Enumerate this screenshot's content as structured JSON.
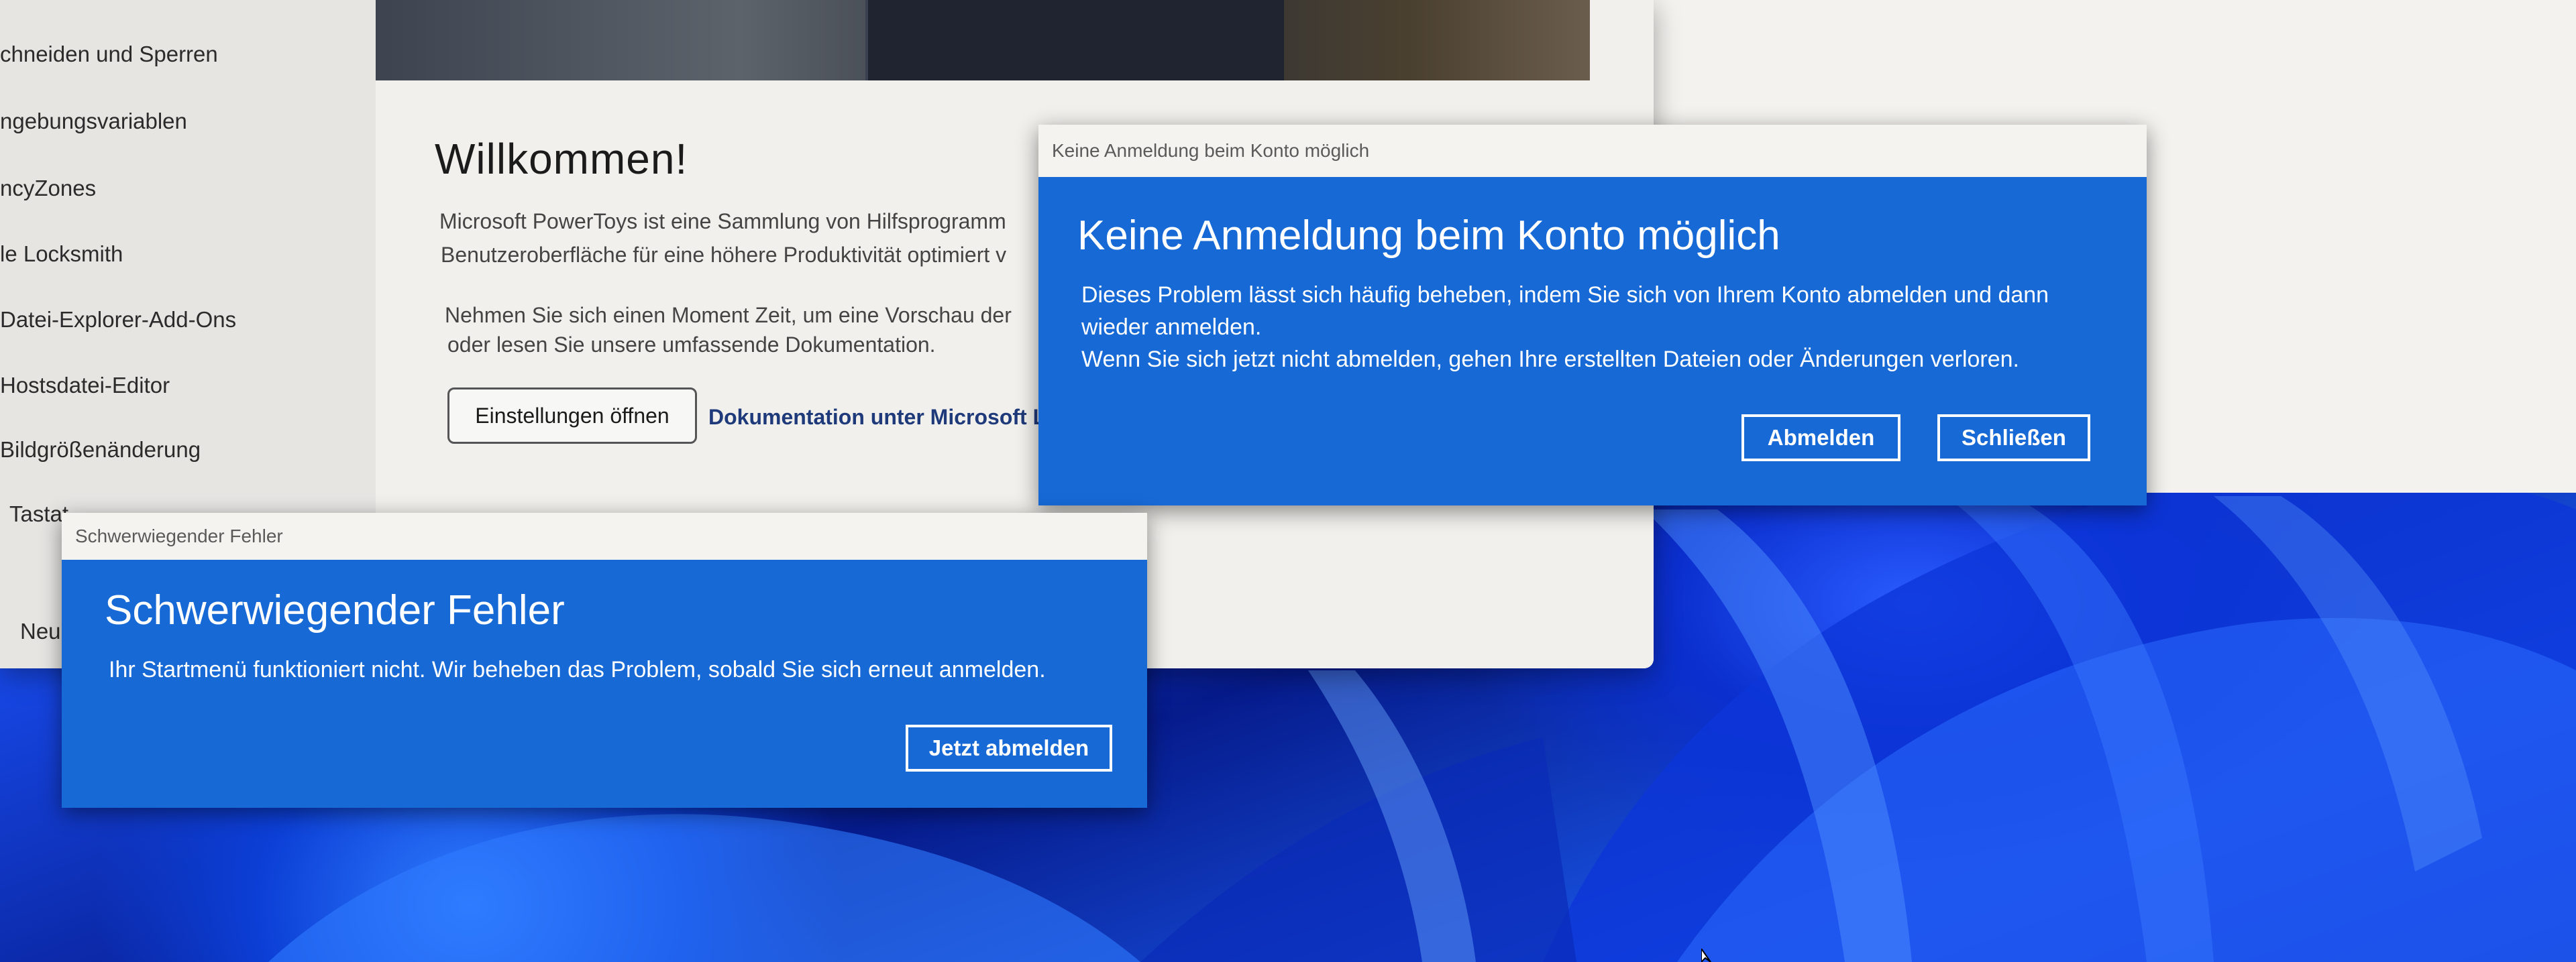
{
  "sidebar": {
    "items": [
      {
        "label": "chneiden und Sperren"
      },
      {
        "label": "ngebungsvariablen"
      },
      {
        "label": "ncyZones"
      },
      {
        "label": "le Locksmith"
      },
      {
        "label": "Datei-Explorer-Add-Ons"
      },
      {
        "label": "Hostsdatei-Editor"
      },
      {
        "label": "Bildgrößenänderung"
      },
      {
        "label": "Tastat"
      },
      {
        "label": "Neui"
      }
    ]
  },
  "welcome": {
    "title": "Willkommen!",
    "para1_line1": "Microsoft PowerToys ist eine Sammlung von Hilfsprogramm",
    "para1_line2": "Benutzeroberfläche für eine höhere Produktivität optimiert v",
    "para2_line1": "Nehmen Sie sich einen Moment Zeit, um eine Vorschau der",
    "para2_line2": "oder lesen Sie unsere umfassende Dokumentation.",
    "open_settings_label": "Einstellungen öffnen",
    "docs_link_label": "Dokumentation unter Microsoft L"
  },
  "dialog_account": {
    "window_title": "Keine Anmeldung beim Konto möglich",
    "heading": "Keine Anmeldung beim Konto möglich",
    "message_line1": "Dieses Problem lässt sich häufig beheben, indem Sie sich von Ihrem Konto abmelden und dann",
    "message_line2": "wieder anmelden.",
    "message_line3": "Wenn Sie sich jetzt nicht abmelden, gehen Ihre erstellten Dateien oder Änderungen verloren.",
    "signout_label": "Abmelden",
    "close_label": "Schließen"
  },
  "dialog_fatal": {
    "window_title": "Schwerwiegender Fehler",
    "heading": "Schwerwiegender Fehler",
    "message": "Ihr Startmenü funktioniert nicht. Wir beheben das Problem, sobald Sie sich erneut anmelden.",
    "signout_now_label": "Jetzt abmelden"
  },
  "colors": {
    "dialog_blue": "#1769d6",
    "titlebar": "#f4f3ef",
    "wallpaper_blue": "#1748e6"
  },
  "icons": {
    "cursor": "mouse-pointer-icon"
  }
}
